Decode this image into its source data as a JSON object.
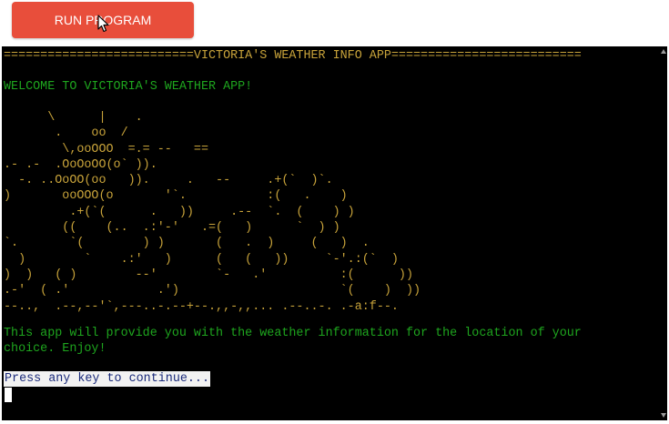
{
  "button": {
    "run_label": "RUN PROGRAM"
  },
  "terminal": {
    "banner": "==========================VICTORIA'S WEATHER INFO APP==========================",
    "welcome": "WELCOME TO VICTORIA'S WEATHER APP!",
    "ascii_art": "      \\      |    .\n       .    oo  /\n        \\,ooOOO  =.= --   ==\n.- .-  .OoOoOO(o` )).\n  -. ..OoOO(oo   )).     .   --     .+(`  )`.\n)       ooOOO(o       '`.           :(   .    )\n         .+(`(      .   ))     .--  `.  (    ) )\n        ((    (..  .:'-'   .=(   )      `  ) )\n`.       `(        ) )       (   .  )     (   )  .\n  )        `    .:'   )      (   (   ))     `-'.:(`  )\n)  )   ( )        --'        `-   .'          :(      ))\n.-'  ( .'            .')                      `(    )  ))\n--..,  .--,--'`,---..-.--+--.,,-,,... .--..-. .-a:f--.",
    "info": "This app will provide you with the weather information for the location of your\nchoice. Enjoy!",
    "prompt": "Press any key to continue..."
  },
  "colors": {
    "button_bg": "#e84e3b",
    "terminal_bg": "#000000",
    "banner_text": "#c8a33a",
    "green_text": "#1ea51e"
  },
  "icons": {
    "pointer": "mouse-pointer-icon",
    "scroll_up": "scroll-up-arrow-icon",
    "scroll_down": "scroll-down-arrow-icon"
  }
}
